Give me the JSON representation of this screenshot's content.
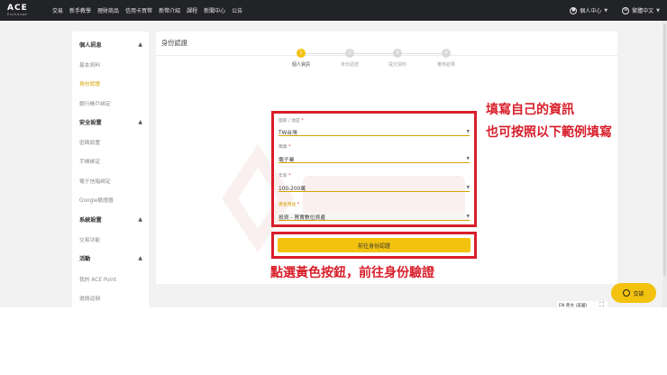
{
  "brand": {
    "name": "ACE",
    "tagline": "Exchange"
  },
  "nav": {
    "items": [
      "交易",
      "新手教學",
      "理財商品",
      "信用卡買幣",
      "新幣介紹",
      "課程",
      "新聞中心",
      "公告"
    ]
  },
  "nav_right": {
    "account": "個人中心",
    "language": "繁體中文"
  },
  "sidebar": {
    "sections": [
      {
        "title": "個人訊息",
        "items": [
          "基本資料",
          "身份認證",
          "銀行帳戶綁定"
        ]
      },
      {
        "title": "安全設置",
        "items": [
          "密碼設置",
          "手機綁定",
          "電子信箱綁定",
          "Google驗證器"
        ]
      },
      {
        "title": "系統設置",
        "items": [
          "交易功能"
        ]
      },
      {
        "title": "活動",
        "items": [
          "我的 ACE Point",
          "邀請返佣"
        ]
      }
    ],
    "active_item": "身份認證"
  },
  "main": {
    "title": "身份認證",
    "steps": [
      {
        "number": "1",
        "label": "個人資訊"
      },
      {
        "number": "2",
        "label": "身份認證"
      },
      {
        "number": "3",
        "label": "提交資料"
      },
      {
        "number": "4",
        "label": "審核結果"
      }
    ],
    "fields": [
      {
        "label": "國家 / 地區",
        "value": "TW台灣"
      },
      {
        "label": "職業",
        "value": "電子業"
      },
      {
        "label": "年薪",
        "value": "100-200萬"
      },
      {
        "label": "資金用途",
        "value": "投資 - 買賣數位資產"
      }
    ],
    "required_mark": "*",
    "submit_label": "前往身份認證"
  },
  "annotations": {
    "fill_line1": "填寫自己的資訊",
    "fill_line2": "也可按照以下範例填寫",
    "click_hint": "點選黃色按鈕，前往身份驗證"
  },
  "chat": {
    "label": "交談"
  },
  "lang_bar": {
    "label": "EN 英文 (美國)"
  },
  "colors": {
    "accent": "#f2c20f",
    "annotation_red": "#d81e2a",
    "topbar": "#222326"
  }
}
